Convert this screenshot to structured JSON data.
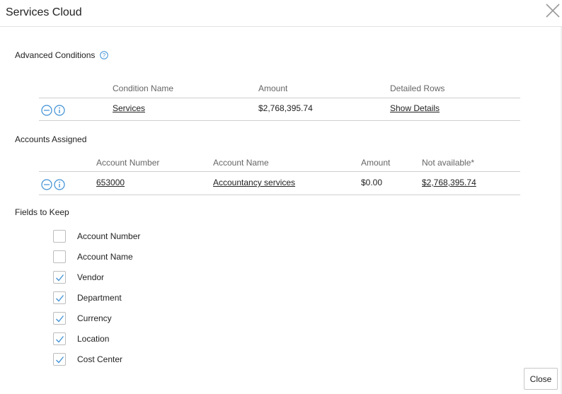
{
  "dialog": {
    "title": "Services Cloud",
    "close_button": "Close"
  },
  "advanced_conditions": {
    "label": "Advanced Conditions",
    "headers": {
      "condition_name": "Condition Name",
      "amount": "Amount",
      "detailed_rows": "Detailed Rows"
    },
    "rows": [
      {
        "condition_name": "Services",
        "amount": "$2,768,395.74",
        "detailed_rows": "Show Details"
      }
    ]
  },
  "accounts_assigned": {
    "label": "Accounts Assigned",
    "headers": {
      "account_number": "Account Number",
      "account_name": "Account Name",
      "amount": "Amount",
      "not_available": "Not available*"
    },
    "rows": [
      {
        "account_number": "653000",
        "account_name": "Accountancy services",
        "amount": "$0.00",
        "not_available": "$2,768,395.74"
      }
    ]
  },
  "fields_to_keep": {
    "label": "Fields to Keep",
    "items": [
      {
        "label": "Account Number",
        "checked": false
      },
      {
        "label": "Account Name",
        "checked": false
      },
      {
        "label": "Vendor",
        "checked": true
      },
      {
        "label": "Department",
        "checked": true
      },
      {
        "label": "Currency",
        "checked": true
      },
      {
        "label": "Location",
        "checked": true
      },
      {
        "label": "Cost Center",
        "checked": true
      }
    ]
  },
  "colors": {
    "accent": "#3d8fd4",
    "border": "#cfcfcf"
  }
}
